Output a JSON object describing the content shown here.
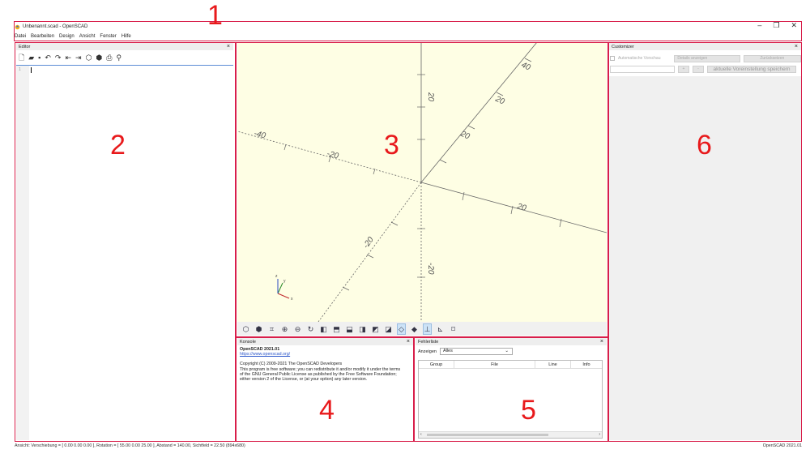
{
  "window": {
    "title": "Unbenannt.scad - OpenSCAD",
    "minimize": "–",
    "restore": "❐",
    "close": "✕"
  },
  "menu": [
    "Datei",
    "Bearbeiten",
    "Design",
    "Ansicht",
    "Fenster",
    "Hilfe"
  ],
  "annotations": [
    "1",
    "2",
    "3",
    "4",
    "5",
    "6"
  ],
  "editor": {
    "title": "Editor",
    "close": "×",
    "line_number": "1",
    "toolbar_icons": [
      "new-file",
      "open-file",
      "save-file",
      "undo",
      "redo",
      "unindent",
      "indent",
      "preview",
      "render",
      "export-stl",
      "send-to-printer"
    ]
  },
  "viewport": {
    "axis_labels": {
      "y_pos": "20",
      "y_neg": "-20",
      "x_neg_far": "-40",
      "x_neg": "-20",
      "x_pos": "20",
      "z_neg": "-20",
      "diag1": "40",
      "diag2": "20",
      "diag3": "20"
    },
    "gizmo": {
      "x": "x",
      "y": "y",
      "z": "z"
    },
    "toolbar_icons": [
      "preview",
      "render",
      "view-all",
      "zoom-in",
      "zoom-out",
      "reset-view",
      "view-right",
      "view-top",
      "view-bottom",
      "view-left",
      "view-front",
      "view-back",
      "perspective",
      "orthogonal",
      "show-axes",
      "show-scale-markers",
      "show-edges"
    ],
    "accent": "#fefee4"
  },
  "console": {
    "title": "Konsole",
    "close": "×",
    "heading": "OpenSCAD 2021.01",
    "url": "https://www.openscad.org/",
    "copyright": "Copyright (C) 2009-2021 The OpenSCAD Developers",
    "license_lines": [
      "This program is free software; you can redistribute it and/or modify it under the terms",
      "of the GNU General Public License as published by the Free Software Foundation;",
      "either version 2 of the License, or (at your option) any later version."
    ]
  },
  "errors": {
    "title": "Fehlerliste",
    "close": "×",
    "filter_label": "Anzeigen",
    "filter_value": "Alles",
    "columns": [
      "Group",
      "File",
      "Line",
      "Info"
    ],
    "scroll_left": "‹",
    "scroll_right": "›"
  },
  "customizer": {
    "title": "Customizer",
    "close": "×",
    "auto_preview": "Automatische Vorschau",
    "details": "Details anzeigen",
    "reset": "Zurücksetzen",
    "plus": "+",
    "minus": "-",
    "save_preset": "aktuelle Voreinstellung speichern"
  },
  "statusbar": {
    "left": "Ansicht: Verschiebung = [ 0.00 0.00 0.00 ], Rotation = [ 55.00 0.00 25.00 ], Abstand = 140.00, Sichtfeld = 22.50 (894x680)",
    "right": "OpenSCAD 2021.01"
  },
  "colors": {
    "annotation_red": "#d81e4a",
    "annotation_number": "#e8191b"
  }
}
